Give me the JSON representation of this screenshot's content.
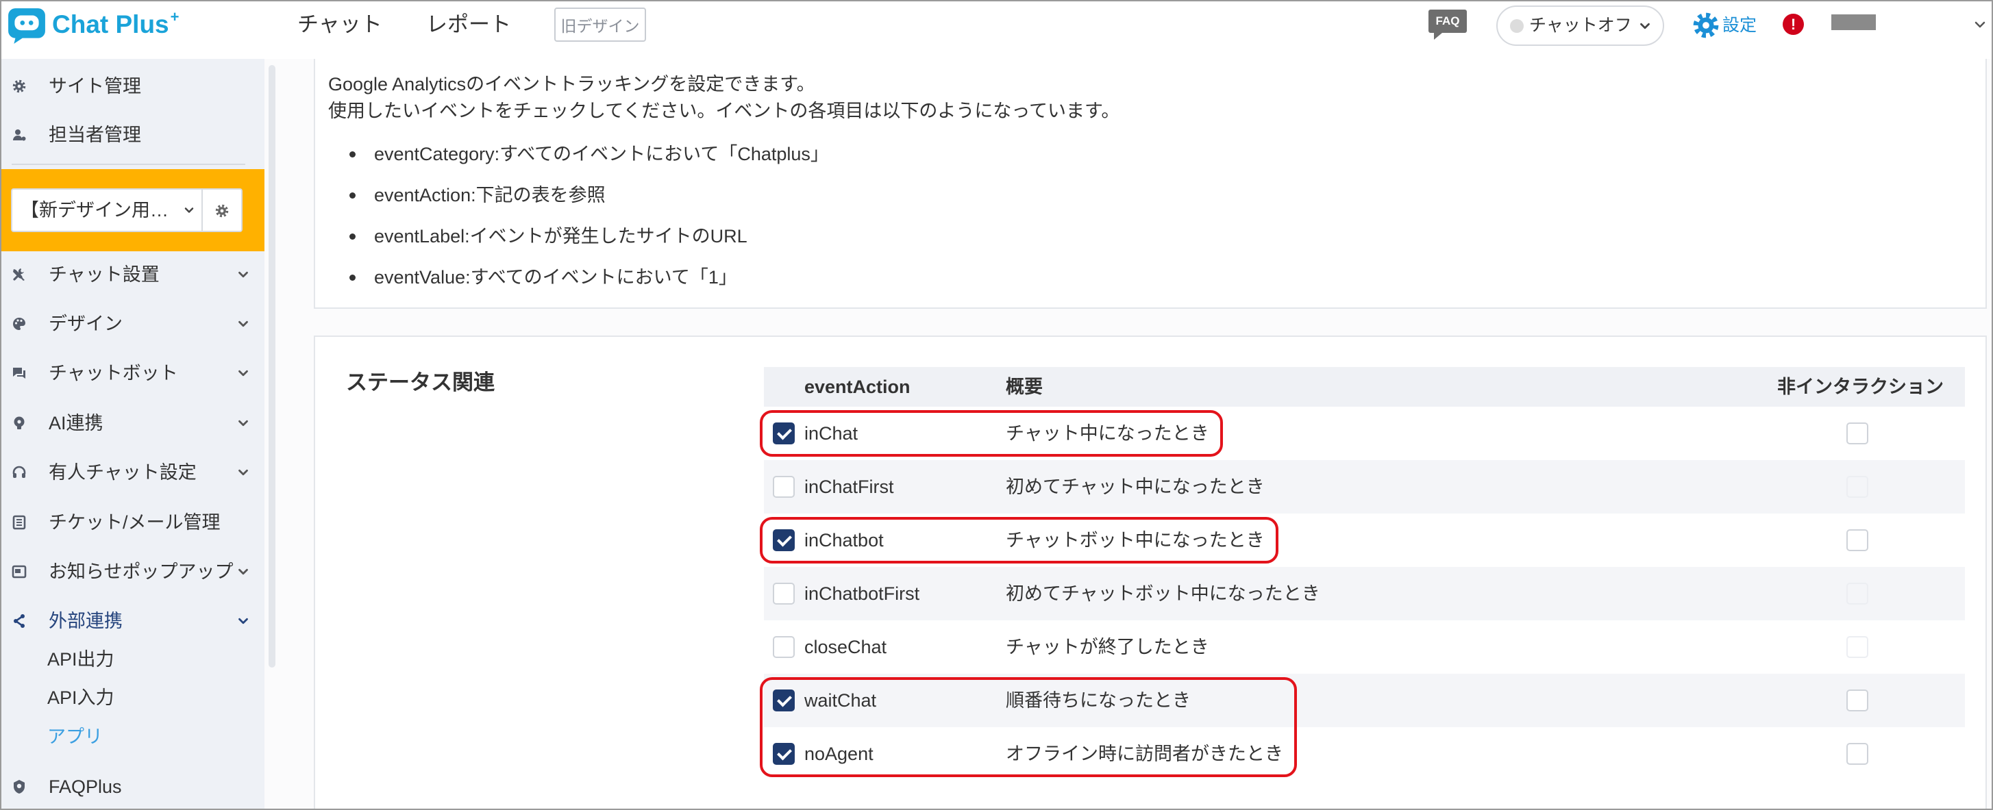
{
  "colors": {
    "brand": "#1aa3d9",
    "orange": "#ffb100",
    "check": "#1f3b6e",
    "highlight": "#e3131b",
    "active_link": "#3b9fe1",
    "section_active": "#26457e",
    "settings": "#1b8fd6"
  },
  "header": {
    "logo": "Chat Plus",
    "logo_plus": "+",
    "nav_chat": "チャット",
    "nav_report": "レポート",
    "old_design": "旧デザイン",
    "faq": "FAQ",
    "chat_status": "チャットオフ",
    "settings": "設定",
    "alert": "!"
  },
  "sidebar": {
    "site_management": "サイト管理",
    "agent_management": "担当者管理",
    "site_select": "【新デザイン用…",
    "menu": [
      {
        "label": "チャット設置",
        "icon": "tools-icon"
      },
      {
        "label": "デザイン",
        "icon": "palette-icon"
      },
      {
        "label": "チャットボット",
        "icon": "chatbot-icon"
      },
      {
        "label": "AI連携",
        "icon": "ai-icon"
      },
      {
        "label": "有人チャット設定",
        "icon": "headset-icon"
      },
      {
        "label": "チケット/メール管理",
        "icon": "ticket-icon"
      },
      {
        "label": "お知らせポップアップ",
        "icon": "popup-icon"
      },
      {
        "label": "外部連携",
        "icon": "share-icon",
        "expanded": true
      }
    ],
    "sub_menu": [
      {
        "label": "API出力"
      },
      {
        "label": "API入力"
      },
      {
        "label": "アプリ",
        "active": true
      }
    ],
    "faqplus": "FAQPlus"
  },
  "intro": {
    "line1": "Google Analyticsのイベントトラッキングを設定できます。",
    "line2": "使用したいイベントをチェックしてください。イベントの各項目は以下のようになっています。",
    "bullets": [
      "eventCategory:すべてのイベントにおいて「Chatplus」",
      "eventAction:下記の表を参照",
      "eventLabel:イベントが発生したサイトのURL",
      "eventValue:すべてのイベントにおいて「1」"
    ]
  },
  "status_section": {
    "title": "ステータス関連",
    "columns": {
      "event_action": "eventAction",
      "summary": "概要",
      "non_interaction": "非インタラクション"
    },
    "rows": [
      {
        "event": "inChat",
        "summary": "チャット中になったとき",
        "checked": true,
        "non_interaction": false
      },
      {
        "event": "inChatFirst",
        "summary": "初めてチャット中になったとき",
        "checked": false,
        "non_interaction": false
      },
      {
        "event": "inChatbot",
        "summary": "チャットボット中になったとき",
        "checked": true,
        "non_interaction": false
      },
      {
        "event": "inChatbotFirst",
        "summary": "初めてチャットボット中になったとき",
        "checked": false,
        "non_interaction": false
      },
      {
        "event": "closeChat",
        "summary": "チャットが終了したとき",
        "checked": false,
        "non_interaction": false
      },
      {
        "event": "waitChat",
        "summary": "順番待ちになったとき",
        "checked": true,
        "non_interaction": false
      },
      {
        "event": "noAgent",
        "summary": "オフライン時に訪問者がきたとき",
        "checked": true,
        "non_interaction": false
      }
    ],
    "highlighted_rows": [
      [
        0
      ],
      [
        2
      ],
      [
        5,
        6
      ]
    ]
  }
}
